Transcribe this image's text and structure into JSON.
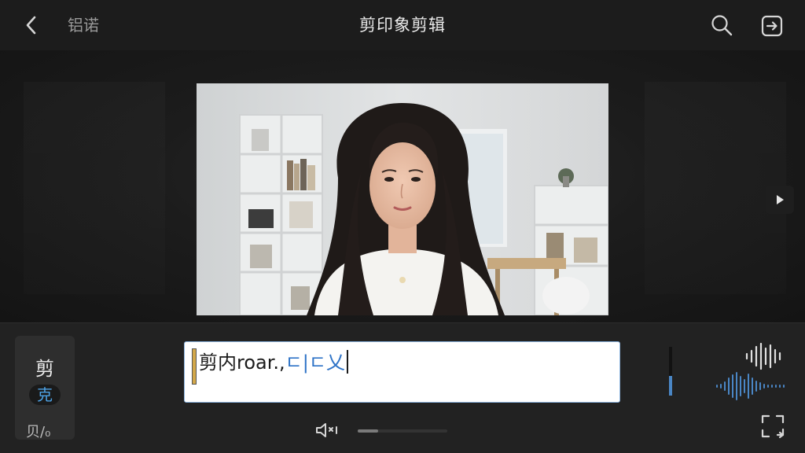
{
  "header": {
    "back_label": "铝诺",
    "title": "剪印象剪辑",
    "icons": {
      "back": "chevron-left-icon",
      "search": "search-icon",
      "export": "export-icon"
    }
  },
  "preview": {
    "icons": {
      "play": "play-icon"
    }
  },
  "side_card": {
    "glyph_top": "剪",
    "glyph_mid": "克",
    "glyph_bottom": "贝/₀"
  },
  "editor": {
    "text_main": "剪内roar.,",
    "text_accent": "ㄷ|ㄷ乂"
  },
  "audio": {
    "level_fraction": 0.4,
    "progress_fraction": 0.23,
    "icons": {
      "mute": "speaker-muted-icon",
      "fullscreen": "fullscreen-icon"
    }
  },
  "colors": {
    "accent_blue": "#2e73c7",
    "meter_blue": "#4a86c5",
    "caret_gold": "#d3a84a"
  }
}
